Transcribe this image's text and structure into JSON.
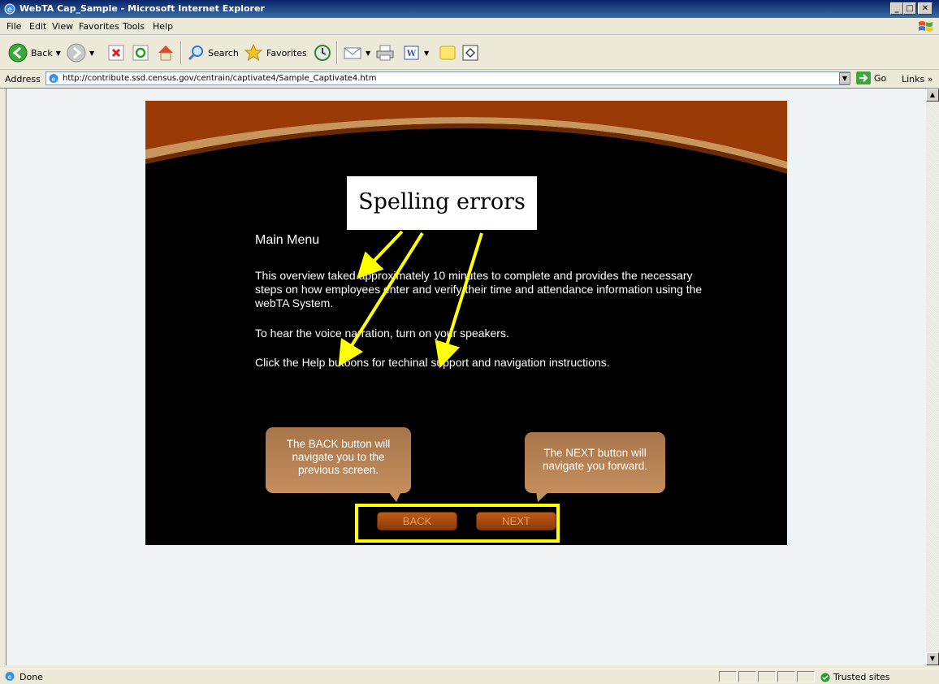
{
  "window": {
    "title": "WebTA Cap_Sample - Microsoft Internet Explorer",
    "buttons": [
      "_",
      "□",
      "✕"
    ]
  },
  "menu": [
    "File",
    "Edit",
    "View",
    "Favorites",
    "Tools",
    "Help"
  ],
  "toolbar": {
    "back_label": "Back",
    "search_label": "Search",
    "favorites_label": "Favorites"
  },
  "address": {
    "label": "Address",
    "url": "http://contribute.ssd.census.gov/centrain/captivate4/Sample_Captivate4.htm",
    "go_label": "Go",
    "links_label": "Links"
  },
  "lesson": {
    "callout": "Spelling errors",
    "heading": "Main Menu",
    "paragraph1": "This overview taked approximately 10 minutes to complete and provides the necessary steps on how employees enter and verify their time and attendance information using the webTA System.",
    "paragraph2": "To hear the voice narration, turn on your speakers.",
    "paragraph3": "Click the Help butoons for techinal support and navigation instructions.",
    "tip_back": "The BACK button will navigate you to the previous screen.",
    "tip_next": "The NEXT button will navigate you forward.",
    "back_button": "BACK",
    "next_button": "NEXT"
  },
  "status": {
    "text": "Done",
    "zone": "Trusted sites"
  },
  "colors": {
    "highlight": "#ffff00",
    "arrow": "#ffff00",
    "banner": "#9a3a06"
  }
}
